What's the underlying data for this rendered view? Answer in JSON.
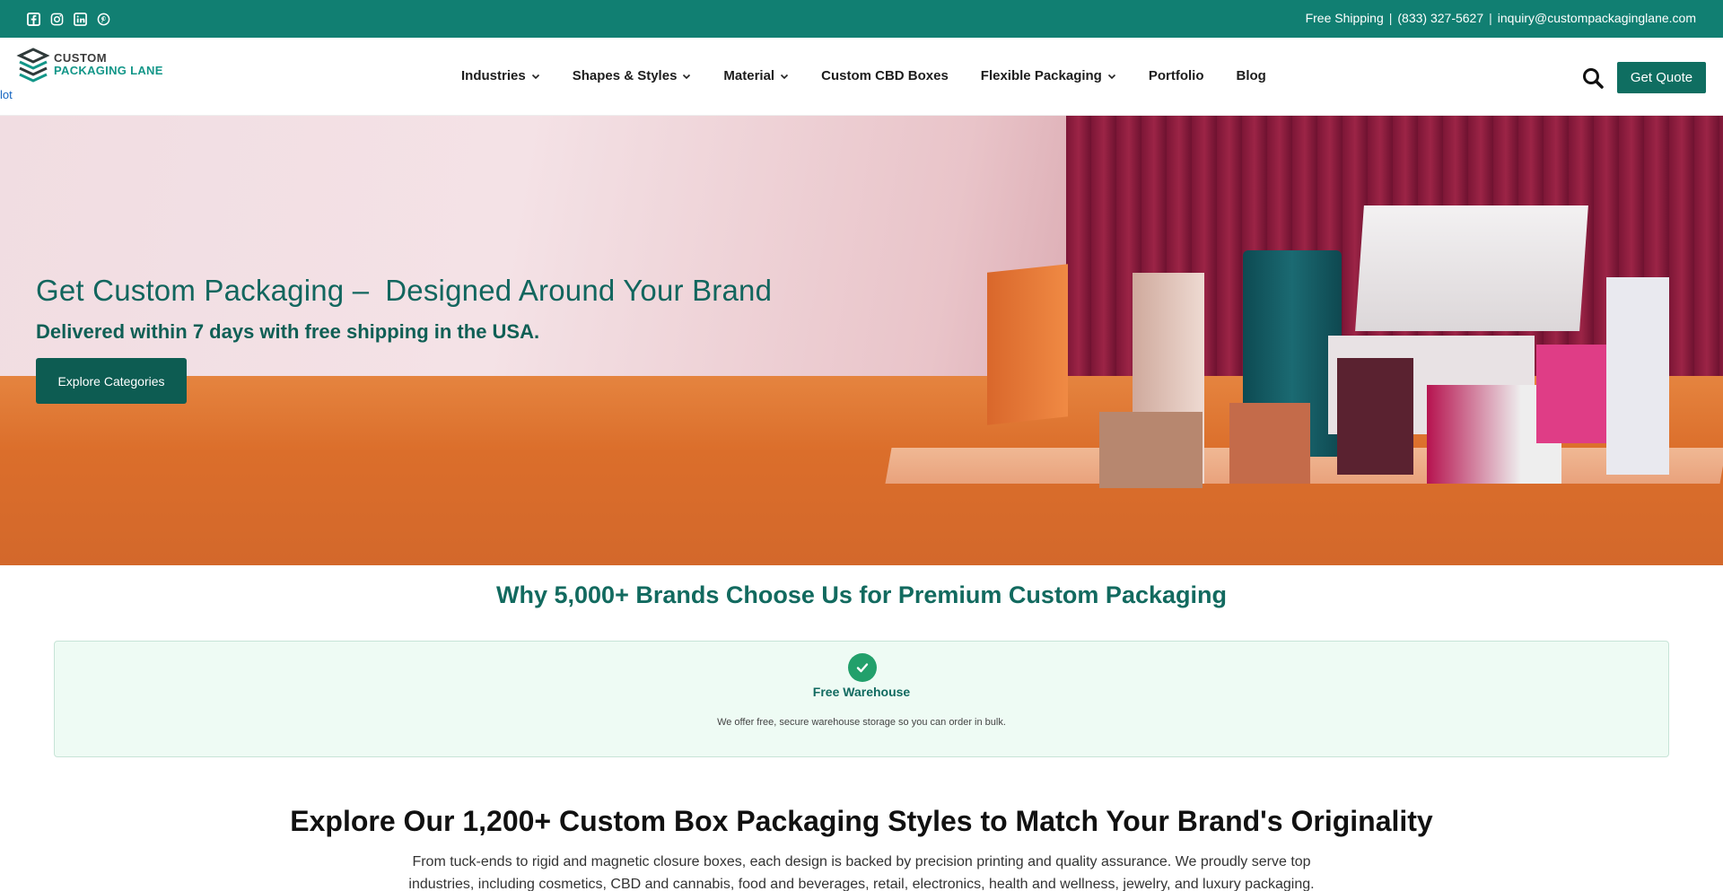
{
  "topbar": {
    "icons": [
      "facebook-icon",
      "instagram-icon",
      "linkedin-icon",
      "pinterest-icon"
    ],
    "shipping": "Free Shipping",
    "phone": "(833) 327-5627",
    "email": "inquiry@custompackaginglane.com",
    "sep": "|"
  },
  "logo": {
    "line1": "CUSTOM",
    "line2": "PACKAGING LANE"
  },
  "stray_text": "lot",
  "nav": {
    "items": [
      {
        "label": "Industries",
        "has_dropdown": true
      },
      {
        "label": "Shapes & Styles",
        "has_dropdown": true
      },
      {
        "label": "Material",
        "has_dropdown": true
      },
      {
        "label": "Custom CBD Boxes",
        "has_dropdown": false
      },
      {
        "label": "Flexible Packaging",
        "has_dropdown": true
      },
      {
        "label": "Portfolio",
        "has_dropdown": false
      },
      {
        "label": "Blog",
        "has_dropdown": false
      }
    ],
    "quote_label": "Get Quote"
  },
  "hero": {
    "title_part1": "Get Custom Packaging –",
    "title_part2": "Designed Around Your Brand",
    "subtitle": "Delivered within 7 days with free shipping in the USA.",
    "cta": "Explore Categories"
  },
  "why": {
    "title": "Why 5,000+ Brands Choose Us for Premium Custom Packaging",
    "feature": {
      "title": "Free Warehouse",
      "desc": "We offer free, secure warehouse storage so you can order in bulk."
    }
  },
  "explore": {
    "title": "Explore Our 1,200+ Custom Box Packaging Styles to Match Your Brand's Originality",
    "desc": "From tuck-ends to rigid and magnetic closure boxes, each design is backed by precision printing and quality assurance. We proudly serve top industries, including cosmetics, CBD and cannabis, food and beverages, retail, electronics, health and wellness, jewelry, and luxury packaging."
  },
  "colors": {
    "brand_teal": "#117f72",
    "dark_teal": "#0f6e61",
    "accent_green": "#22a06b"
  }
}
